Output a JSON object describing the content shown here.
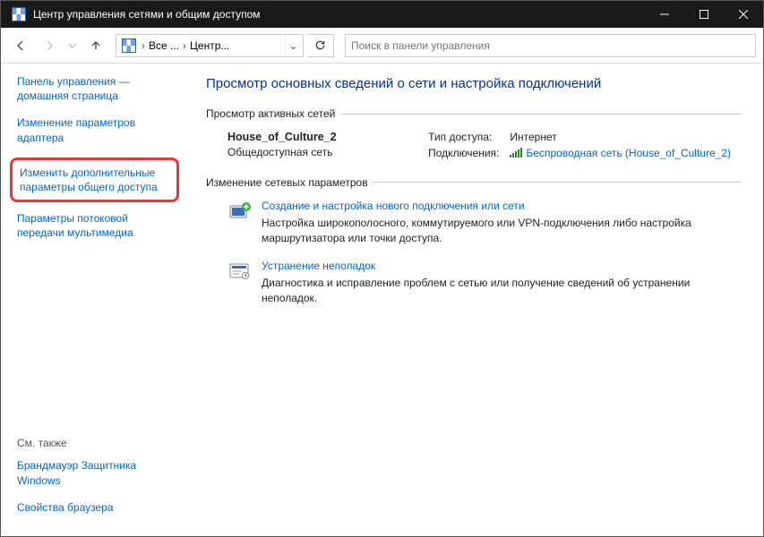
{
  "window": {
    "title": "Центр управления сетями и общим доступом"
  },
  "address": {
    "crumb1": "Все ...",
    "crumb2": "Центр..."
  },
  "search": {
    "placeholder": "Поиск в панели управления"
  },
  "sidebar": {
    "items": [
      "Панель управления — домашняя страница",
      "Изменение параметров адаптера",
      "Изменить дополнительные параметры общего доступа",
      "Параметры потоковой передачи мультимедиа"
    ],
    "see_also_label": "См. также",
    "see_also": [
      "Брандмауэр Защитника Windows",
      "Свойства браузера"
    ]
  },
  "content": {
    "title": "Просмотр основных сведений о сети и настройка подключений",
    "active_networks_label": "Просмотр активных сетей",
    "network": {
      "name": "House_of_Culture_2",
      "type": "Общедоступная сеть",
      "access_label": "Тип доступа:",
      "access_value": "Интернет",
      "conn_label": "Подключения:",
      "conn_value": "Беспроводная сеть (House_of_Culture_2)"
    },
    "change_settings_label": "Изменение сетевых параметров",
    "tasks": [
      {
        "title": "Создание и настройка нового подключения или сети",
        "desc": "Настройка широкополосного, коммутируемого или VPN-подключения либо настройка маршрутизатора или точки доступа."
      },
      {
        "title": "Устранение неполадок",
        "desc": "Диагностика и исправление проблем с сетью или получение сведений об устранении неполадок."
      }
    ]
  }
}
